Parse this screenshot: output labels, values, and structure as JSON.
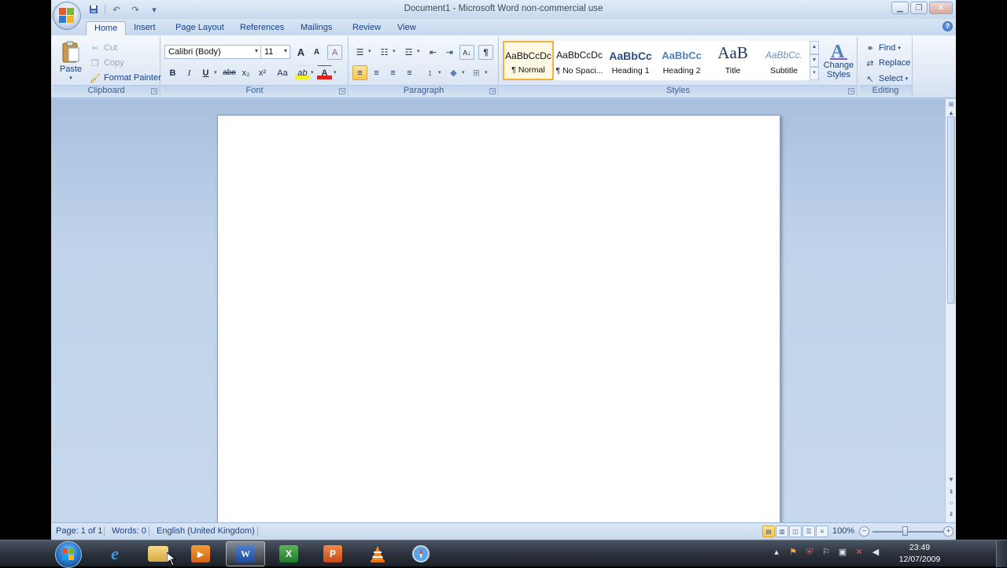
{
  "window": {
    "title": "Document1 - Microsoft Word non-commercial use",
    "controls": {
      "minimize": "▁",
      "restore": "❐",
      "close": "✕"
    }
  },
  "quick_access": {
    "save": "save-icon",
    "undo": "undo-icon",
    "redo": "redo-icon",
    "customize": "▾"
  },
  "tabs": [
    "Home",
    "Insert",
    "Page Layout",
    "References",
    "Mailings",
    "Review",
    "View"
  ],
  "active_tab": "Home",
  "ribbon": {
    "clipboard": {
      "label": "Clipboard",
      "paste": "Paste",
      "cut": "Cut",
      "copy": "Copy",
      "format_painter": "Format Painter"
    },
    "font": {
      "label": "Font",
      "font_name": "Calibri (Body)",
      "font_size": "11",
      "grow": "A",
      "shrink": "A",
      "clear": "A",
      "bold": "B",
      "italic": "I",
      "underline": "U",
      "strikethrough": "abe",
      "subscript": "x₂",
      "superscript": "x²",
      "change_case": "Aa",
      "highlight": "ab",
      "font_color": "A"
    },
    "paragraph": {
      "label": "Paragraph",
      "bullets": "☰",
      "numbering": "☷",
      "multilevel": "☲",
      "decrease_indent": "⇤",
      "increase_indent": "⇥",
      "sort": "A↓",
      "show_marks": "¶",
      "align_left": "≡",
      "center": "≡",
      "align_right": "≡",
      "justify": "≡",
      "line_spacing": "↕",
      "shading": "◆",
      "borders": "⊞"
    },
    "styles": {
      "label": "Styles",
      "items": [
        {
          "sample": "AaBbCcDc",
          "name": "¶ Normal"
        },
        {
          "sample": "AaBbCcDc",
          "name": "¶ No Spaci..."
        },
        {
          "sample": "AaBbCc",
          "name": "Heading 1"
        },
        {
          "sample": "AaBbCc",
          "name": "Heading 2"
        },
        {
          "sample": "AaB",
          "name": "Title"
        },
        {
          "sample": "AaBbCc.",
          "name": "Subtitle"
        }
      ],
      "change_styles_1": "Change",
      "change_styles_2": "Styles"
    },
    "editing": {
      "label": "Editing",
      "find": "Find",
      "replace": "Replace",
      "select": "Select"
    }
  },
  "status": {
    "page": "Page: 1 of 1",
    "words": "Words: 0",
    "language": "English (United Kingdom)",
    "zoom": "100%",
    "zoom_out": "−",
    "zoom_in": "+"
  },
  "taskbar": {
    "apps": [
      "start-button",
      "internet-explorer",
      "windows-explorer",
      "media-player",
      "microsoft-word",
      "microsoft-excel",
      "microsoft-powerpoint",
      "vlc-player",
      "safari"
    ],
    "time": "23:49",
    "date": "12/07/2009"
  },
  "colors": {
    "accent": "#15428b",
    "ribbon": "#dfe9f5",
    "doc_bg": "#c4d5ec",
    "selected": "#f9c54d"
  }
}
